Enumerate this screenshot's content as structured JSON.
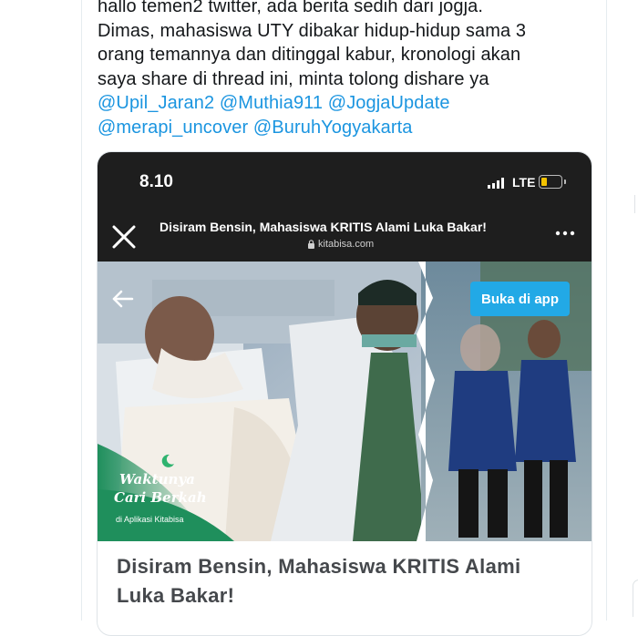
{
  "tweet": {
    "lines": [
      "hallo temen2 twitter, ada berita sedih dari jogja.",
      "Dimas, mahasiswa UTY dibakar hidup-hidup sama 3",
      "orang temannya dan ditinggal kabur, kronologi akan",
      "saya share di thread ini, minta tolong dishare ya"
    ],
    "mentions": [
      "@Upil_Jaran2",
      "@Muthia911",
      "@JogjaUpdate",
      "@merapi_uncover",
      "@BuruhYogyakarta"
    ]
  },
  "phone": {
    "time": "8.10",
    "network": "LTE",
    "battery_level": 0.3,
    "battery_color": "#f2c200"
  },
  "browser": {
    "page_title": "Disiram Bensin, Mahasiswa KRITIS Alami Luka Bakar!",
    "domain": "kitabisa.com",
    "close_icon": "close-icon",
    "more_icon": "more-dots-icon"
  },
  "hero": {
    "open_app_label": "Buka di app",
    "open_app_color": "#22a9e6",
    "promo_line1": "Waktunya",
    "promo_line2": "Cari Berkah",
    "promo_line3": "di Aplikasi Kitabisa"
  },
  "card": {
    "title_line1": "Disiram Bensin, Mahasiswa KRITIS Alami",
    "title_line2": "Luka Bakar!"
  },
  "colors": {
    "mention": "#1b95e0",
    "text": "#14171a",
    "card_title": "#45484c"
  }
}
